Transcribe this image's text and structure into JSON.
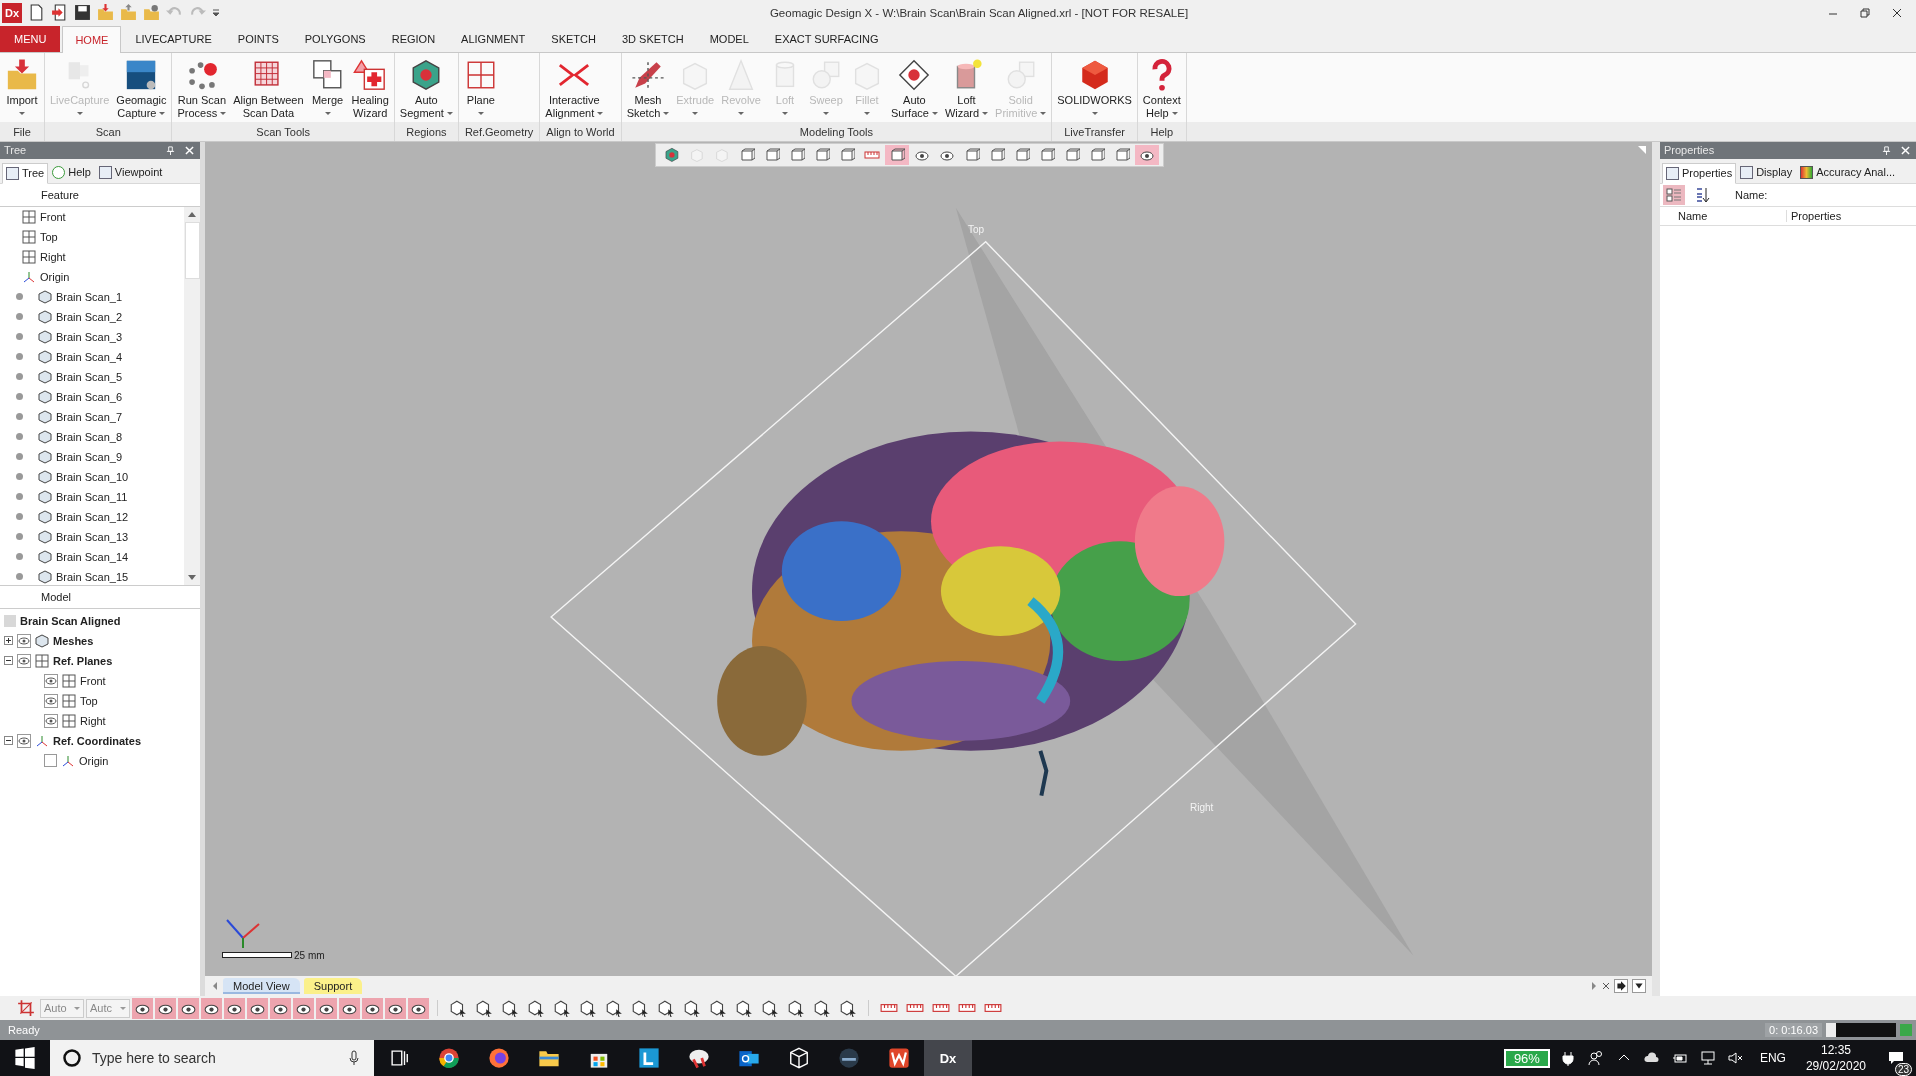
{
  "window": {
    "logo": "Dx",
    "title": "Geomagic Design X - W:\\Brain Scan\\Brain Scan Aligned.xrl - [NOT FOR RESALE]"
  },
  "ribbon_tabs": [
    {
      "label": "MENU",
      "kind": "menu",
      "selected": false
    },
    {
      "label": "HOME",
      "kind": "tab",
      "selected": true
    },
    {
      "label": "LIVECAPTURE",
      "kind": "tab",
      "selected": false
    },
    {
      "label": "POINTS",
      "kind": "tab",
      "selected": false
    },
    {
      "label": "POLYGONS",
      "kind": "tab",
      "selected": false
    },
    {
      "label": "REGION",
      "kind": "tab",
      "selected": false
    },
    {
      "label": "ALIGNMENT",
      "kind": "tab",
      "selected": false
    },
    {
      "label": "SKETCH",
      "kind": "tab",
      "selected": false
    },
    {
      "label": "3D SKETCH",
      "kind": "tab",
      "selected": false
    },
    {
      "label": "MODEL",
      "kind": "tab",
      "selected": false
    },
    {
      "label": "EXACT SURFACING",
      "kind": "tab",
      "selected": false
    }
  ],
  "ribbon_groups": [
    {
      "label": "File",
      "buttons": [
        {
          "lines": [
            "Import"
          ],
          "dropdown": true,
          "disabled": false
        }
      ]
    },
    {
      "label": "Scan",
      "buttons": [
        {
          "lines": [
            "LiveCapture"
          ],
          "dropdown": true,
          "disabled": true
        },
        {
          "lines": [
            "Geomagic",
            "Capture"
          ],
          "dropdown": true,
          "disabled": false
        }
      ]
    },
    {
      "label": "Scan Tools",
      "buttons": [
        {
          "lines": [
            "Run Scan",
            "Process"
          ],
          "dropdown": true,
          "disabled": false
        },
        {
          "lines": [
            "Align Between",
            "Scan Data"
          ],
          "dropdown": false,
          "disabled": false
        },
        {
          "lines": [
            "Merge"
          ],
          "dropdown": true,
          "disabled": false
        },
        {
          "lines": [
            "Healing",
            "Wizard"
          ],
          "dropdown": false,
          "disabled": false
        }
      ]
    },
    {
      "label": "Regions",
      "buttons": [
        {
          "lines": [
            "Auto",
            "Segment"
          ],
          "dropdown": true,
          "disabled": false
        }
      ]
    },
    {
      "label": "Ref.Geometry",
      "buttons": [
        {
          "lines": [
            "Plane"
          ],
          "dropdown": true,
          "disabled": false
        }
      ]
    },
    {
      "label": "Align to World",
      "buttons": [
        {
          "lines": [
            "Interactive",
            "Alignment"
          ],
          "dropdown": true,
          "disabled": false
        }
      ]
    },
    {
      "label": "Modeling Tools",
      "buttons": [
        {
          "lines": [
            "Mesh",
            "Sketch"
          ],
          "dropdown": true,
          "disabled": false
        },
        {
          "lines": [
            "Extrude"
          ],
          "dropdown": true,
          "disabled": true
        },
        {
          "lines": [
            "Revolve"
          ],
          "dropdown": true,
          "disabled": true
        },
        {
          "lines": [
            "Loft"
          ],
          "dropdown": true,
          "disabled": true
        },
        {
          "lines": [
            "Sweep"
          ],
          "dropdown": true,
          "disabled": true
        },
        {
          "lines": [
            "Fillet"
          ],
          "dropdown": true,
          "disabled": true
        },
        {
          "lines": [
            "Auto",
            "Surface"
          ],
          "dropdown": true,
          "disabled": false
        },
        {
          "lines": [
            "Loft",
            "Wizard"
          ],
          "dropdown": true,
          "disabled": false
        },
        {
          "lines": [
            "Solid",
            "Primitive"
          ],
          "dropdown": true,
          "disabled": true
        }
      ]
    },
    {
      "label": "LiveTransfer",
      "buttons": [
        {
          "lines": [
            "SOLIDWORKS"
          ],
          "dropdown": true,
          "disabled": false
        }
      ]
    },
    {
      "label": "Help",
      "buttons": [
        {
          "lines": [
            "Context",
            "Help"
          ],
          "dropdown": true,
          "disabled": false
        }
      ]
    }
  ],
  "tree_panel": {
    "title": "Tree",
    "tabs": [
      {
        "label": "Tree",
        "selected": true
      },
      {
        "label": "Help",
        "selected": false
      },
      {
        "label": "Viewpoint",
        "selected": false
      }
    ],
    "feature_header": "Feature",
    "features": [
      {
        "label": "Front",
        "kind": "plane"
      },
      {
        "label": "Top",
        "kind": "plane"
      },
      {
        "label": "Right",
        "kind": "plane"
      },
      {
        "label": "Origin",
        "kind": "origin"
      },
      {
        "label": "Brain Scan_1",
        "kind": "scan"
      },
      {
        "label": "Brain Scan_2",
        "kind": "scan"
      },
      {
        "label": "Brain Scan_3",
        "kind": "scan"
      },
      {
        "label": "Brain Scan_4",
        "kind": "scan"
      },
      {
        "label": "Brain Scan_5",
        "kind": "scan"
      },
      {
        "label": "Brain Scan_6",
        "kind": "scan"
      },
      {
        "label": "Brain Scan_7",
        "kind": "scan"
      },
      {
        "label": "Brain Scan_8",
        "kind": "scan"
      },
      {
        "label": "Brain Scan_9",
        "kind": "scan"
      },
      {
        "label": "Brain Scan_10",
        "kind": "scan"
      },
      {
        "label": "Brain Scan_11",
        "kind": "scan"
      },
      {
        "label": "Brain Scan_12",
        "kind": "scan"
      },
      {
        "label": "Brain Scan_13",
        "kind": "scan"
      },
      {
        "label": "Brain Scan_14",
        "kind": "scan"
      },
      {
        "label": "Brain Scan_15",
        "kind": "scan"
      }
    ],
    "model_header": "Model",
    "model": [
      {
        "label": "Brain Scan Aligned",
        "children": [
          {
            "label": "Meshes",
            "kind": "mesh",
            "visible": true,
            "expanded": false
          },
          {
            "label": "Ref. Planes",
            "kind": "plane",
            "visible": true,
            "expanded": true,
            "children": [
              {
                "label": "Front",
                "kind": "plane",
                "visible": true
              },
              {
                "label": "Top",
                "kind": "plane",
                "visible": true
              },
              {
                "label": "Right",
                "kind": "plane",
                "visible": true
              }
            ]
          },
          {
            "label": "Ref. Coordinates",
            "kind": "origin",
            "visible": true,
            "expanded": true,
            "children": [
              {
                "label": "Origin",
                "kind": "origin",
                "checked": false
              }
            ]
          }
        ]
      }
    ]
  },
  "viewport": {
    "view_tools": [
      {
        "selected": false
      },
      {
        "selected": false
      },
      {
        "selected": false
      },
      {
        "selected": false
      },
      {
        "selected": false
      },
      {
        "selected": false
      },
      {
        "selected": false
      },
      {
        "selected": false
      },
      {
        "selected": false
      },
      {
        "selected": true
      },
      {
        "selected": false
      },
      {
        "selected": false
      },
      {
        "selected": false
      },
      {
        "selected": false
      },
      {
        "selected": false
      },
      {
        "selected": false
      },
      {
        "selected": false
      },
      {
        "selected": false
      },
      {
        "selected": false
      },
      {
        "selected": true
      }
    ],
    "plane_labels": [
      "Top",
      "Right"
    ],
    "scale": "25 mm",
    "tabs": [
      {
        "label": "Model View",
        "selected": true,
        "color": "#d6e4f5"
      },
      {
        "label": "Support",
        "selected": false,
        "color": "#fbf08a"
      }
    ]
  },
  "properties_panel": {
    "title": "Properties",
    "tabs": [
      {
        "label": "Properties",
        "selected": true
      },
      {
        "label": "Display",
        "selected": false
      },
      {
        "label": "Accuracy Anal..."
      }
    ],
    "sort_buttons": [
      {
        "kind": "categorized",
        "selected": true
      },
      {
        "kind": "alphabetical",
        "selected": false
      }
    ],
    "name_label": "Name:",
    "columns": [
      "Name",
      "Properties"
    ]
  },
  "bottom_toolbar": {
    "combos": [
      "Auto",
      "Autc"
    ],
    "filters": [
      {
        "on": true
      },
      {
        "on": true
      },
      {
        "on": true
      },
      {
        "on": true
      },
      {
        "on": true
      },
      {
        "on": true
      },
      {
        "on": true
      },
      {
        "on": true
      },
      {
        "on": true
      },
      {
        "on": true
      },
      {
        "on": true
      },
      {
        "on": true
      },
      {
        "on": true
      }
    ]
  },
  "status_bar": {
    "message": "Ready",
    "timer": "0: 0:16.03"
  },
  "taskbar": {
    "search_placeholder": "Type here to search",
    "active_logo": "Dx",
    "battery": "96%",
    "language": "ENG",
    "time": "12:35",
    "date": "29/02/2020",
    "notifications": "23"
  }
}
